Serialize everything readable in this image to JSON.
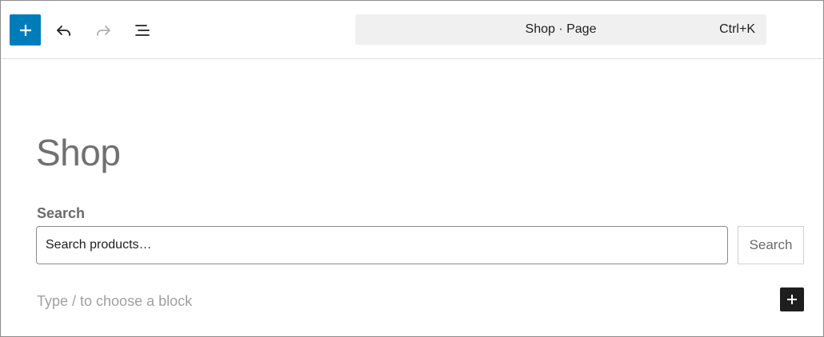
{
  "toolbar": {
    "inserter_icon": "plus-icon",
    "undo_icon": "undo-icon",
    "redo_icon": "redo-icon",
    "outline_icon": "list-view-icon",
    "command_bar": {
      "title": "Shop · Page",
      "shortcut": "Ctrl+K"
    }
  },
  "canvas": {
    "page_title": "Shop",
    "search_block": {
      "label": "Search",
      "placeholder": "Search products…",
      "button_label": "Search"
    },
    "block_prompt": "Type / to choose a block",
    "block_inserter_icon": "plus-icon"
  },
  "colors": {
    "accent": "#007cba",
    "dark": "#1e1e1e",
    "command_bar_bg": "#f0f0f0"
  }
}
